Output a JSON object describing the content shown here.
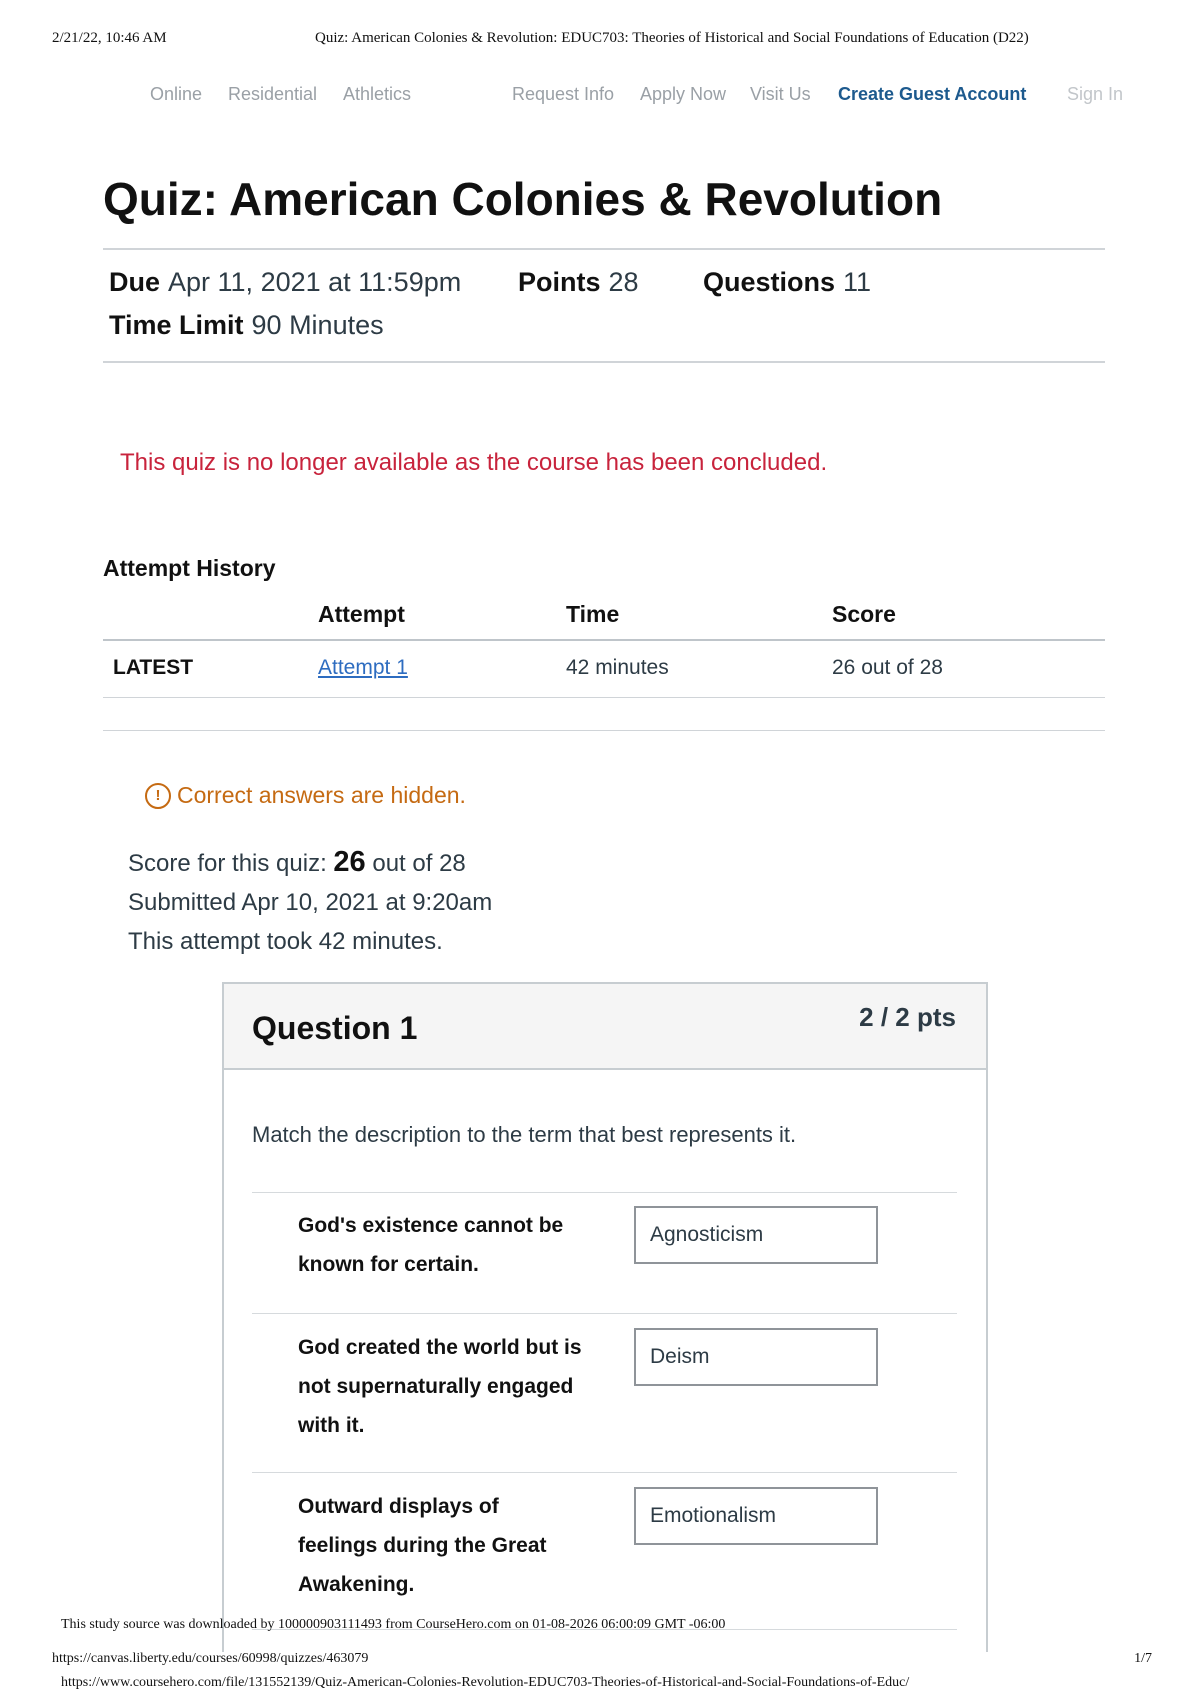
{
  "print_header": {
    "datetime": "2/21/22, 10:46 AM",
    "document_title": "Quiz: American Colonies & Revolution: EDUC703: Theories of Historical and Social Foundations of Education (D22)"
  },
  "top_nav": {
    "online": "Online",
    "residential": "Residential",
    "athletics": "Athletics",
    "request_info": "Request Info",
    "apply_now": "Apply Now",
    "visit_us": "Visit Us",
    "create_guest_account": "Create Guest Account",
    "sign_in": "Sign In"
  },
  "quiz": {
    "title": "Quiz: American Colonies & Revolution",
    "due_label": "Due",
    "due_value": "Apr 11, 2021 at 11:59pm",
    "points_label": "Points",
    "points_value": "28",
    "questions_label": "Questions",
    "questions_value": "11",
    "time_limit_label": "Time Limit",
    "time_limit_value": "90 Minutes",
    "concluded_message": "This quiz is no longer available as the course has been concluded."
  },
  "attempt_history": {
    "heading": "Attempt History",
    "columns": [
      "Attempt",
      "Time",
      "Score"
    ],
    "rows": [
      {
        "tag": "LATEST",
        "attempt": "Attempt 1",
        "time": "42 minutes",
        "score": "26 out of 28"
      }
    ]
  },
  "result": {
    "hidden_notice": "Correct answers are hidden.",
    "score_prefix": "Score for this quiz:",
    "score_value": "26",
    "score_suffix": "out of 28",
    "submitted": "Submitted Apr 10, 2021 at 9:20am",
    "duration": "This attempt took 42 minutes."
  },
  "question_1": {
    "title": "Question 1",
    "points": "2 / 2 pts",
    "prompt": "Match the description to the term that best represents it.",
    "matches": [
      {
        "description_lines": [
          "God's existence cannot be",
          "known for certain."
        ],
        "answer": "Agnosticism"
      },
      {
        "description_lines": [
          "God created the world but is",
          "not supernaturally engaged",
          "with it."
        ],
        "answer": "Deism"
      },
      {
        "description_lines": [
          "Outward displays of",
          "feelings during the Great",
          "Awakening."
        ],
        "answer": "Emotionalism"
      }
    ]
  },
  "footer": {
    "watermark": "This study source was downloaded by 100000903111493 from CourseHero.com on 01-08-2026 06:00:09 GMT -06:00",
    "canvas_url": "https://canvas.liberty.edu/courses/60998/quizzes/463079",
    "page_number": "1/7",
    "coursehero_url": "https://www.coursehero.com/file/131552139/Quiz-American-Colonies-Revolution-EDUC703-Theories-of-Historical-and-Social-Foundations-of-Educ/"
  }
}
